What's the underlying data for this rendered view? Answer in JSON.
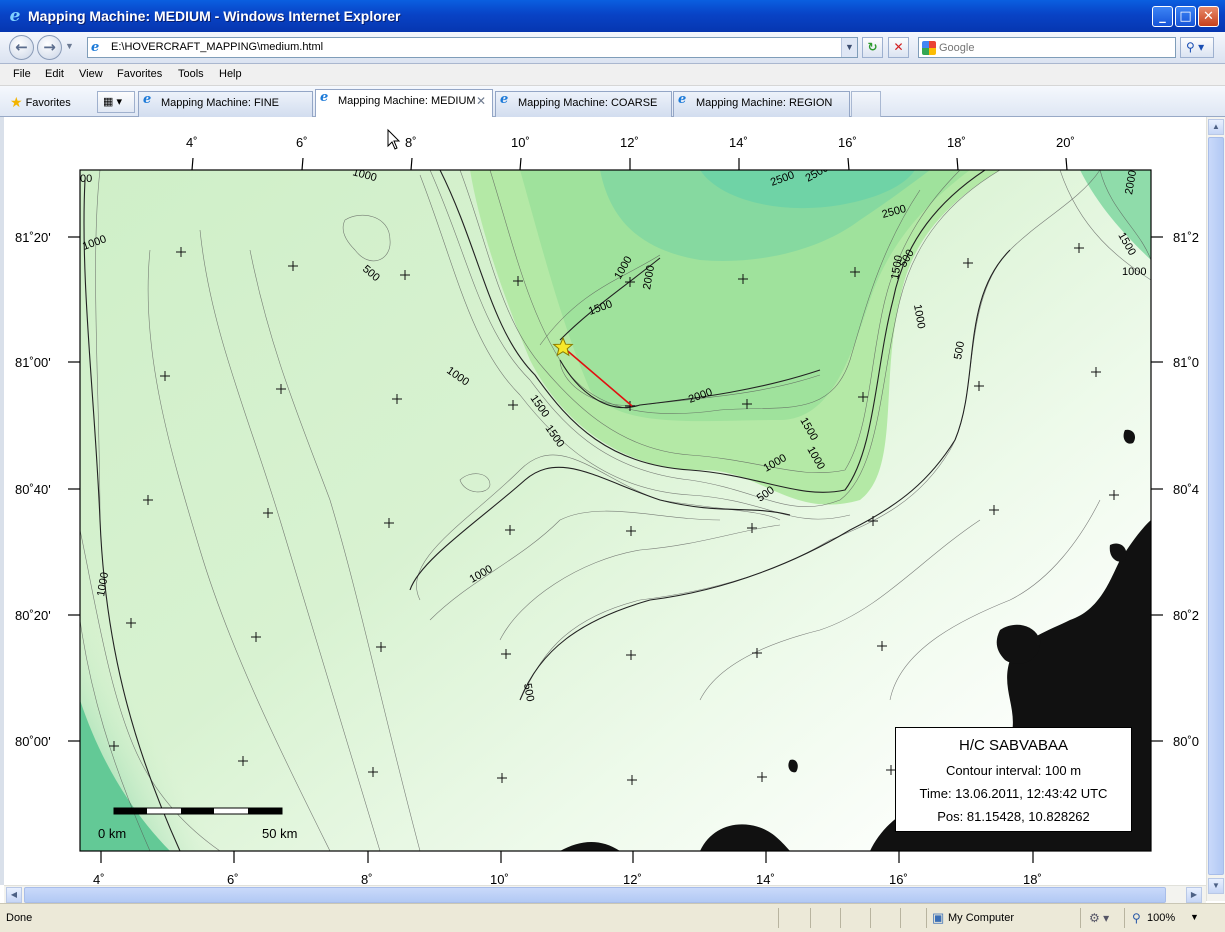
{
  "window": {
    "title": "Mapping Machine: MEDIUM - Windows Internet Explorer",
    "minimize_glyph": "_",
    "maximize_glyph": "□",
    "close_glyph": "✕"
  },
  "toolbar": {
    "back_glyph": "←",
    "forward_glyph": "→",
    "address": "E:\\HOVERCRAFT_MAPPING\\medium.html",
    "refresh_glyph": "↻",
    "stop_glyph": "✕",
    "search_placeholder": "Google",
    "search_glyph": "⚲"
  },
  "menu": [
    "File",
    "Edit",
    "View",
    "Favorites",
    "Tools",
    "Help"
  ],
  "favorites_label": "Favorites",
  "tabs": [
    {
      "label": "Mapping Machine: FINE",
      "active": false
    },
    {
      "label": "Mapping Machine: MEDIUM",
      "active": true
    },
    {
      "label": "Mapping Machine: COARSE",
      "active": false
    },
    {
      "label": "Mapping Machine: REGION",
      "active": false
    }
  ],
  "status": {
    "text": "Done",
    "zone": "My Computer",
    "zoom": "100%"
  },
  "map": {
    "top_lon_labels": [
      "4˚",
      "6˚",
      "8˚",
      "10˚",
      "12˚",
      "14˚",
      "16˚",
      "18˚",
      "20˚"
    ],
    "bottom_lon_labels": [
      "4˚",
      "6˚",
      "8˚",
      "10˚",
      "12˚",
      "14˚",
      "16˚",
      "18˚"
    ],
    "left_lat_labels": [
      "81˚20'",
      "81˚00'",
      "80˚40'",
      "80˚20'",
      "80˚00'"
    ],
    "right_lat_labels": [
      "81˚2",
      "81˚0",
      "80˚4",
      "80˚2",
      "80˚0"
    ],
    "contour_labels": [
      "1000",
      "500",
      "1500",
      "2000",
      "2500",
      "1000",
      "1500",
      "1000",
      "500",
      "1000",
      "500",
      "1000",
      "1500",
      "2000",
      "1500",
      "1000",
      "1500",
      "500",
      "1000",
      "2000",
      "2500",
      "1500",
      "1000",
      "1000",
      "500",
      "00",
      "1000",
      "2500"
    ],
    "scale_bar": {
      "start_label": "0 km",
      "end_label": "50 km"
    },
    "colors": {
      "deep": "#5fcf9e",
      "mid": "#a8e6a0",
      "shallow": "#e6f7e0",
      "land": "#111111",
      "track": "#e01010",
      "star": "#f7e82a"
    }
  },
  "legend": {
    "title": "H/C SABVABAA",
    "contour_interval": "Contour interval: 100 m",
    "time": "Time: 13.06.2011, 12:43:42 UTC",
    "position": "Pos: 81.15428, 10.828262"
  }
}
